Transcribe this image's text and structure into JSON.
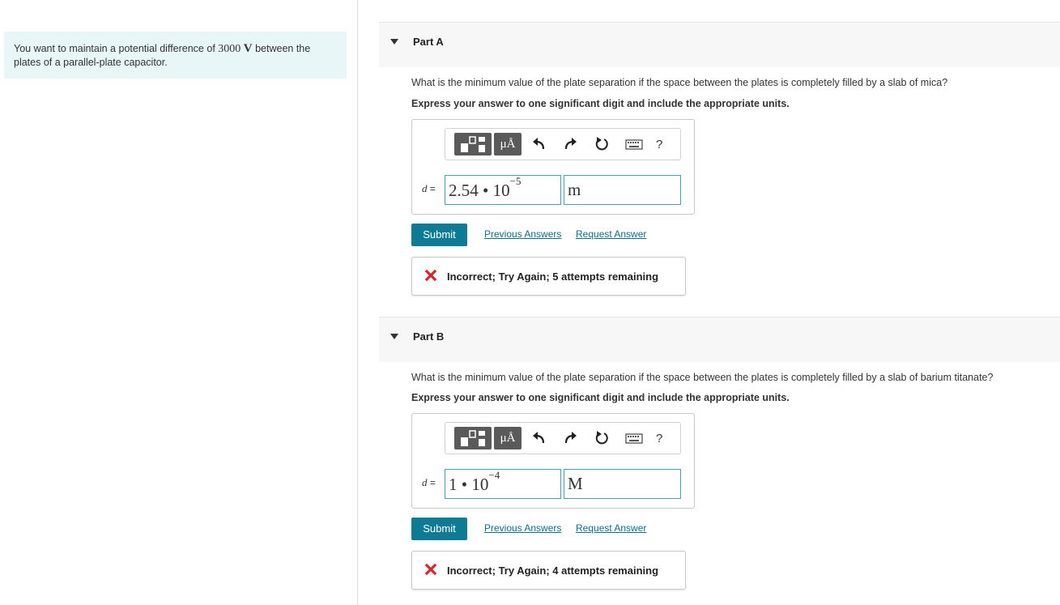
{
  "intro": {
    "text_before": "You want to maintain a potential difference of ",
    "value": "3000",
    "unit": "V",
    "text_after": " between the plates of a parallel-plate capacitor."
  },
  "toolbar": {
    "units_label": "μÅ",
    "help_label": "?"
  },
  "parts": [
    {
      "title": "Part A",
      "question": "What is the minimum value of the plate separation if the space between the plates is completely filled by a slab of mica?",
      "instruction": "Express your answer to one significant digit and include the appropriate units.",
      "variable": "d",
      "equals": "=",
      "value_mantissa": "2.54 • 10",
      "value_exponent": "−5",
      "unit": "m",
      "submit_label": "Submit",
      "previous_answers_label": "Previous Answers",
      "request_answer_label": "Request Answer",
      "feedback": "Incorrect; Try Again; 5 attempts remaining"
    },
    {
      "title": "Part B",
      "question": "What is the minimum value of the plate separation if the space between the plates is completely filled by a slab of barium titanate?",
      "instruction": "Express your answer to one significant digit and include the appropriate units.",
      "variable": "d",
      "equals": "=",
      "value_mantissa": "1 • 10",
      "value_exponent": "−4",
      "unit": "M",
      "submit_label": "Submit",
      "previous_answers_label": "Previous Answers",
      "request_answer_label": "Request Answer",
      "feedback": "Incorrect; Try Again; 4 attempts remaining"
    }
  ],
  "colors": {
    "accent": "#0d7b93",
    "link": "#0d6c86",
    "input_border": "#4aa0a8",
    "intro_bg": "#e8f6f7",
    "error": "#d9262b"
  }
}
